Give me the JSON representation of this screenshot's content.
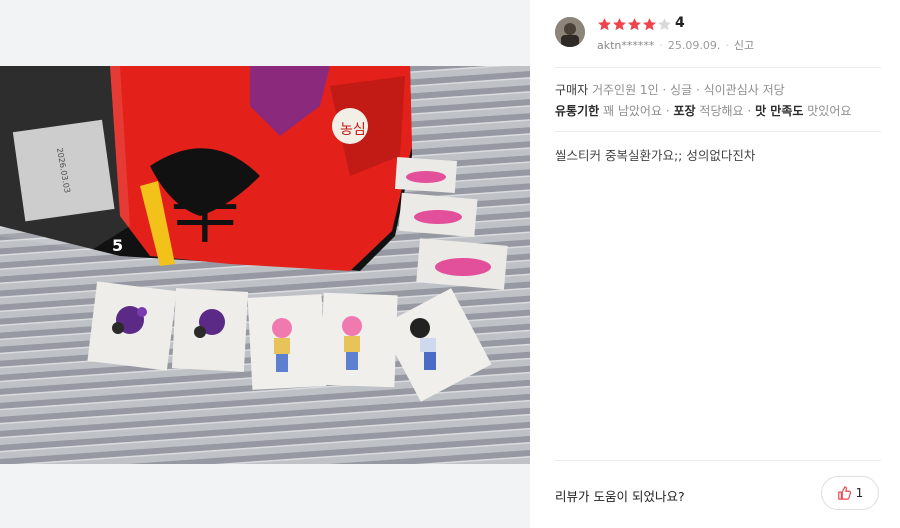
{
  "colors": {
    "star_filled": "#f0444c",
    "star_empty": "#d9d9d9",
    "thumb": "#f0444c"
  },
  "review": {
    "rating": "4",
    "stars_filled": 4,
    "stars_total": 5,
    "username": "aktn******",
    "date": "25.09.09.",
    "report_label": "신고",
    "buyer_label": "구매자",
    "buyer_info": "거주인원 1인 · 싱글 · 식이관심사 저당",
    "attributes": [
      {
        "key": "유통기한",
        "value": "꽤 남았어요"
      },
      {
        "key": "포장",
        "value": "적당해요"
      },
      {
        "key": "맛 만족도",
        "value": "맛있어요"
      }
    ],
    "body": "씰스티커 중복실환가요;; 성의없다진차"
  },
  "helpful": {
    "question": "리뷰가 도움이 되었나요?",
    "count": "1"
  },
  "photo": {
    "package_brand_text": "농심",
    "package_spicy_text": "辛",
    "package_count": "5",
    "package_expiry": "2026.03.03"
  },
  "icons": [
    "star-icon",
    "thumbs-up-icon",
    "avatar"
  ]
}
